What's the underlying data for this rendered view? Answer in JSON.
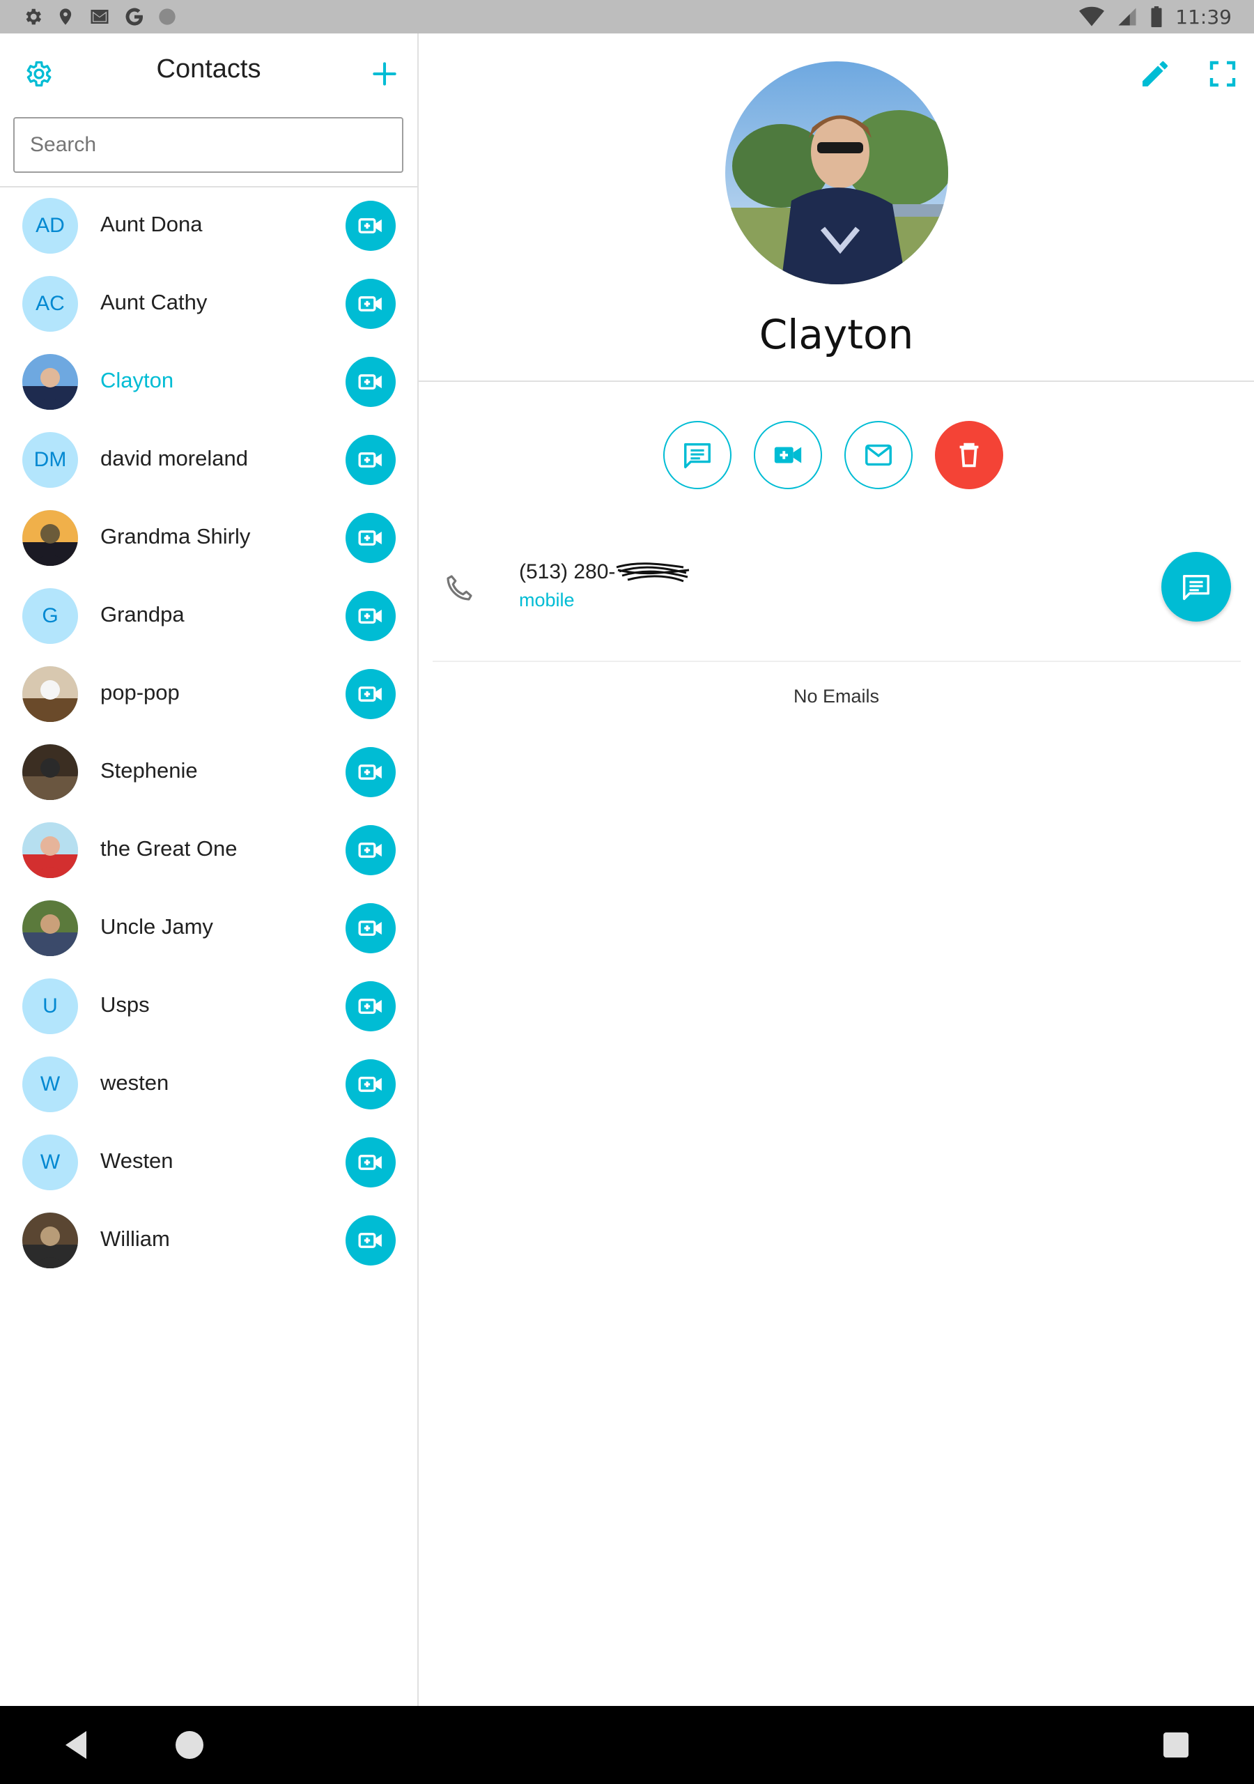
{
  "status_bar": {
    "time": "11:39",
    "left_icons": [
      "gear-icon",
      "location-pin-icon",
      "gmail-icon",
      "google-icon",
      "circle-icon"
    ],
    "right_icons": [
      "wifi-icon",
      "signal-icon",
      "battery-icon"
    ]
  },
  "left_panel": {
    "title": "Contacts",
    "settings_icon": "gear-icon",
    "add_icon": "plus-icon",
    "search": {
      "placeholder": "Search",
      "value": ""
    },
    "contacts": [
      {
        "name": "Aunt Dona",
        "initials": "AD",
        "avatar": "initials",
        "selected": false
      },
      {
        "name": "Aunt Cathy",
        "initials": "AC",
        "avatar": "initials",
        "selected": false
      },
      {
        "name": "Clayton",
        "initials": "",
        "avatar": "photo",
        "selected": true
      },
      {
        "name": "david moreland",
        "initials": "DM",
        "avatar": "initials",
        "selected": false
      },
      {
        "name": "Grandma Shirly",
        "initials": "",
        "avatar": "photo",
        "selected": false
      },
      {
        "name": "Grandpa",
        "initials": "G",
        "avatar": "initials",
        "selected": false
      },
      {
        "name": "pop-pop",
        "initials": "",
        "avatar": "photo",
        "selected": false
      },
      {
        "name": "Stephenie",
        "initials": "",
        "avatar": "photo",
        "selected": false
      },
      {
        "name": "the Great One",
        "initials": "",
        "avatar": "photo",
        "selected": false
      },
      {
        "name": "Uncle Jamy",
        "initials": "",
        "avatar": "photo",
        "selected": false
      },
      {
        "name": "Usps",
        "initials": "U",
        "avatar": "initials",
        "selected": false
      },
      {
        "name": "westen",
        "initials": "W",
        "avatar": "initials",
        "selected": false
      },
      {
        "name": "Westen",
        "initials": "W",
        "avatar": "initials",
        "selected": false
      },
      {
        "name": "William",
        "initials": "",
        "avatar": "photo",
        "selected": false
      }
    ]
  },
  "detail": {
    "name": "Clayton",
    "phone_number": "(513) 280-",
    "phone_type": "mobile",
    "no_emails": "No Emails",
    "actions": [
      "message-icon",
      "video-call-icon",
      "email-icon",
      "trash-icon"
    ]
  },
  "colors": {
    "accent": "#00bcd4",
    "delete": "#f44336",
    "avatar_bg": "#b3e5fc",
    "avatar_text": "#0288d1",
    "status_bar": "#bdbdbd",
    "nav_bar": "#000000"
  }
}
